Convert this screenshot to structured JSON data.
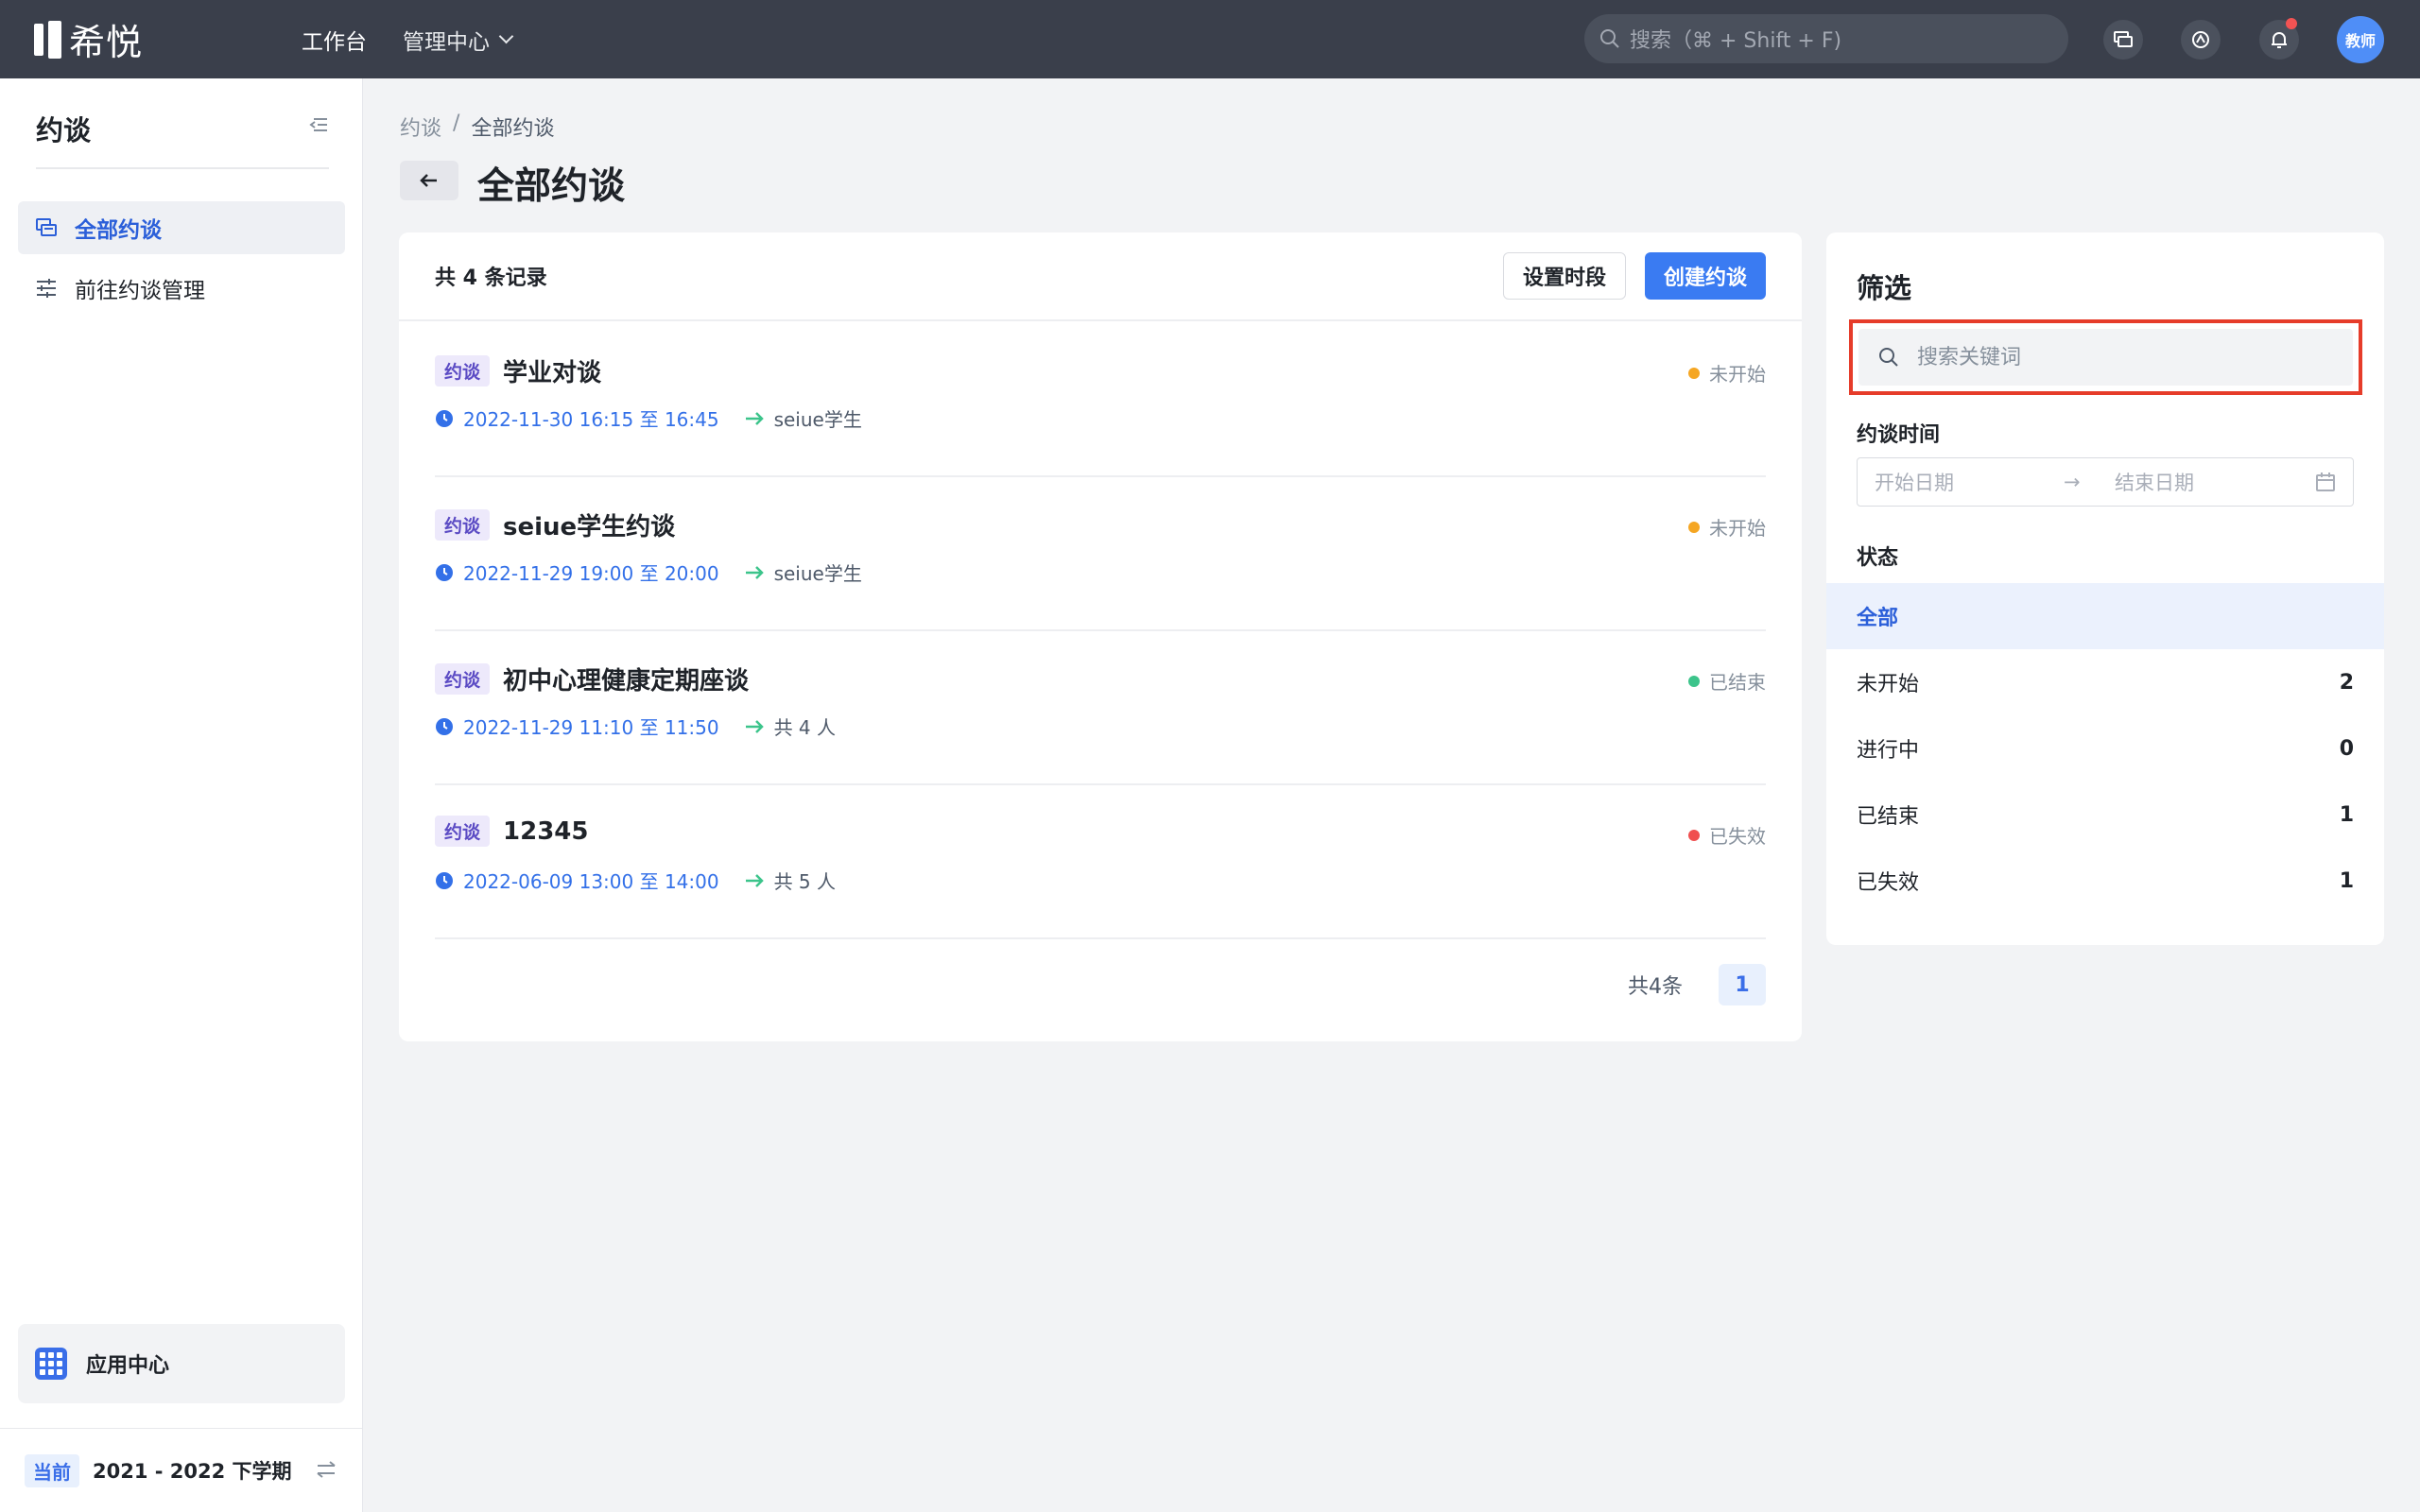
{
  "app": {
    "logo_text": "希悦",
    "user_role": "教师"
  },
  "topnav": {
    "workbench": "工作台",
    "admin_center": "管理中心"
  },
  "global_search": {
    "placeholder": "搜索（⌘ + Shift + F)"
  },
  "sidebar": {
    "title": "约谈",
    "items": [
      {
        "label": "全部约谈",
        "active": true,
        "icon": "chat-list-icon"
      },
      {
        "label": "前往约谈管理",
        "active": false,
        "icon": "sliders-icon"
      }
    ],
    "app_center": "应用中心",
    "term_badge": "当前",
    "term": "2021 - 2022 下学期"
  },
  "breadcrumb": {
    "root": "约谈",
    "separator": "/",
    "current": "全部约谈"
  },
  "page_title": "全部约谈",
  "list": {
    "total_label": "共 4 条记录",
    "set_slot_button": "设置时段",
    "create_button": "创建约谈",
    "rows": [
      {
        "tag": "约谈",
        "title": "学业对谈",
        "time": "2022-11-30 16:15 至 16:45",
        "target": "seiue学生",
        "status": "未开始",
        "status_color": "#f5a623"
      },
      {
        "tag": "约谈",
        "title": "seiue学生约谈",
        "time": "2022-11-29 19:00 至 20:00",
        "target": "seiue学生",
        "status": "未开始",
        "status_color": "#f5a623"
      },
      {
        "tag": "约谈",
        "title": "初中心理健康定期座谈",
        "time": "2022-11-29 11:10 至 11:50",
        "target": "共 4 人",
        "status": "已结束",
        "status_color": "#3cc48b"
      },
      {
        "tag": "约谈",
        "title": "12345",
        "time": "2022-06-09 13:00 至 14:00",
        "target": "共 5 人",
        "status": "已失效",
        "status_color": "#f04f4f"
      }
    ],
    "pagination": {
      "total": "共4条",
      "current_page": "1"
    }
  },
  "filter": {
    "title": "筛选",
    "search_placeholder": "搜索关键词",
    "time_label": "约谈时间",
    "start_placeholder": "开始日期",
    "end_placeholder": "结束日期",
    "status_label": "状态",
    "statuses": [
      {
        "label": "全部",
        "count": "",
        "active": true
      },
      {
        "label": "未开始",
        "count": "2",
        "active": false
      },
      {
        "label": "进行中",
        "count": "0",
        "active": false
      },
      {
        "label": "已结束",
        "count": "1",
        "active": false
      },
      {
        "label": "已失效",
        "count": "1",
        "active": false
      }
    ]
  },
  "colors": {
    "topbar": "#3a3f4b",
    "primary": "#3a7bf2",
    "highlight_border": "#e63c2a"
  }
}
